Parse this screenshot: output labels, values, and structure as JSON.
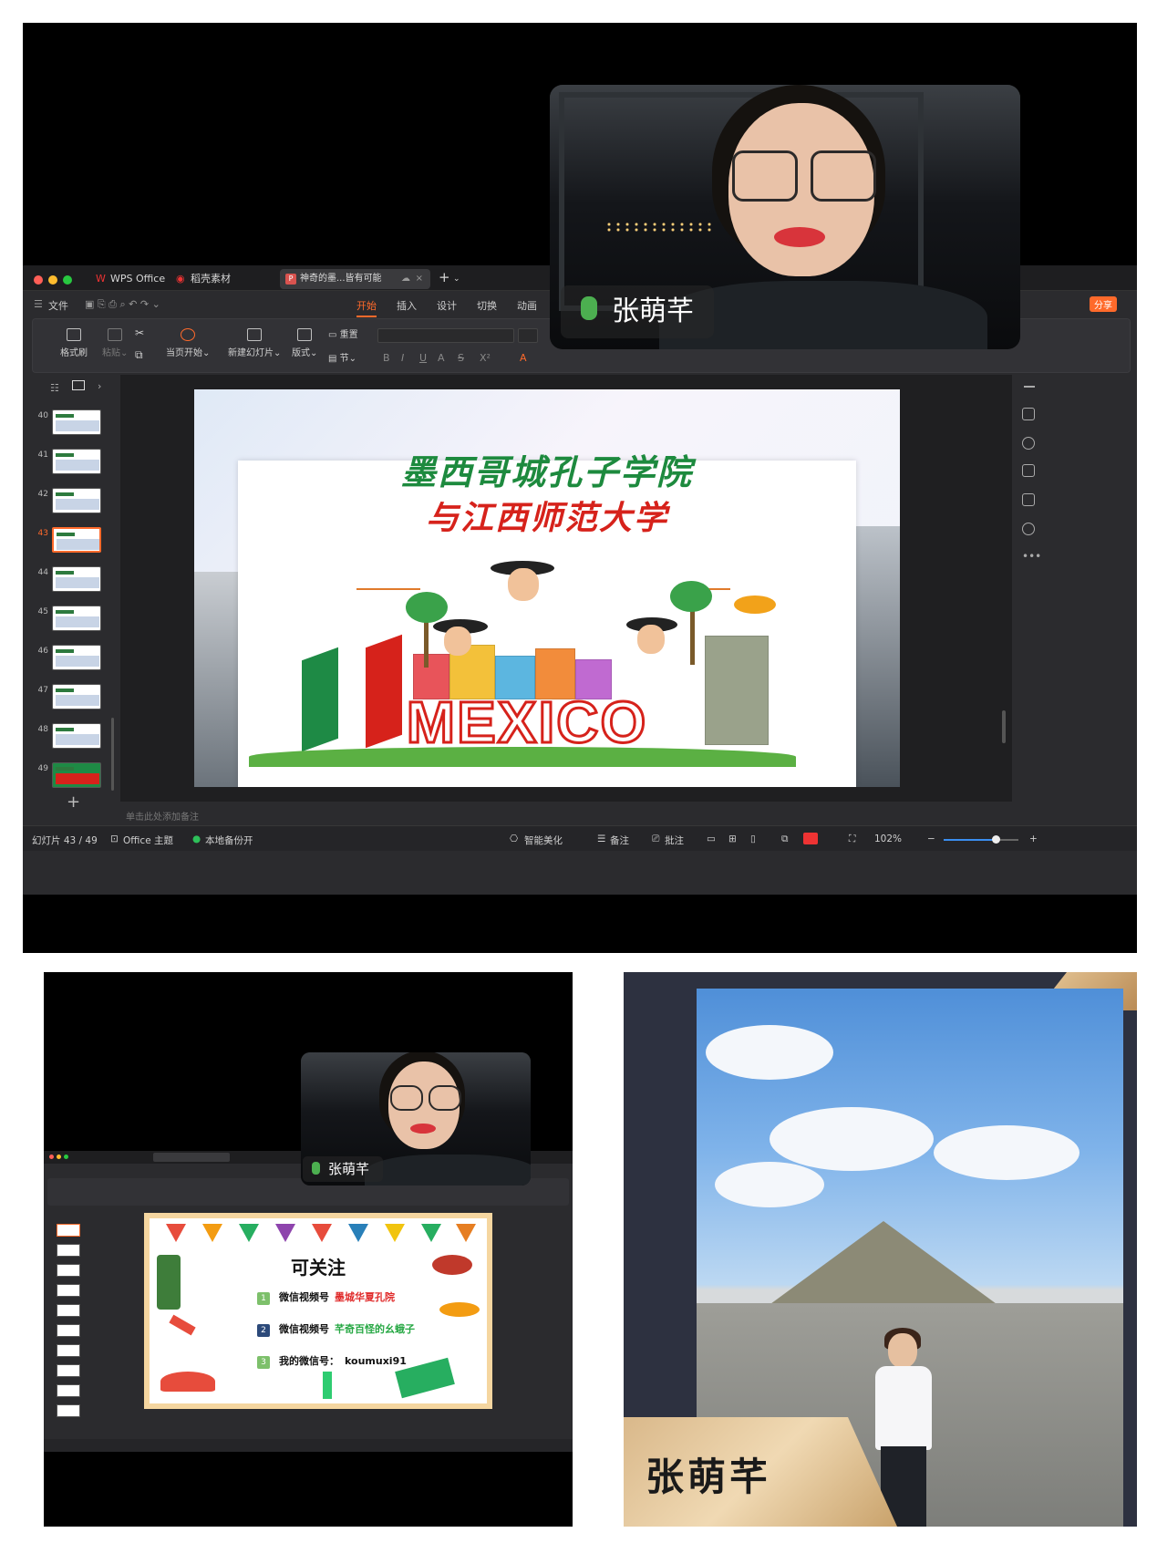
{
  "wps": {
    "app_tab": "WPS Office",
    "material_tab": "稻壳素材",
    "doc_tab": "神奇的墨...皆有可能",
    "menus": [
      "文件",
      "开始",
      "插入",
      "设计",
      "切换",
      "动画"
    ],
    "active_menu": "开始",
    "share": "分享",
    "ribbon": {
      "format_painter": "格式刷",
      "paste": "粘贴",
      "from_start": "当页开始",
      "new_slide": "新建幻灯片",
      "layout": "版式",
      "reset": "重置",
      "section": "节"
    },
    "thumbnail_numbers": [
      "40",
      "41",
      "42",
      "43",
      "44",
      "45",
      "46",
      "47",
      "48",
      "49"
    ],
    "selected_slide": "43",
    "notes_placeholder": "单击此处添加备注",
    "status": {
      "slide_counter": "幻灯片 43 / 49",
      "theme": "Office 主题",
      "backup": "本地备份开",
      "beautify": "智能美化",
      "notes": "备注",
      "comments": "批注",
      "zoom": "102%",
      "zoom_slider_fraction": 0.7
    }
  },
  "slide_main": {
    "title_line1": "墨西哥城孔子学院",
    "title_line2": "与江西师范大学",
    "word": "MEXICO"
  },
  "speaker": {
    "name": "张萌芊"
  },
  "slide_small": {
    "title": "可关注",
    "rows": [
      {
        "num": "1",
        "label": "微信视频号",
        "value": "墨城华夏孔院",
        "value_color": "#e02a2a",
        "num_color": "#7dc06b"
      },
      {
        "num": "2",
        "label": "微信视频号",
        "value": "芊奇百怪的幺蛾子",
        "value_color": "#27a844",
        "num_color": "#2c4a7a"
      },
      {
        "num": "3",
        "label": "我的微信号：",
        "value": "koumuxi91",
        "value_color": "#111111",
        "num_color": "#7dc06b"
      }
    ]
  },
  "accent_color": "#ff6a2b"
}
